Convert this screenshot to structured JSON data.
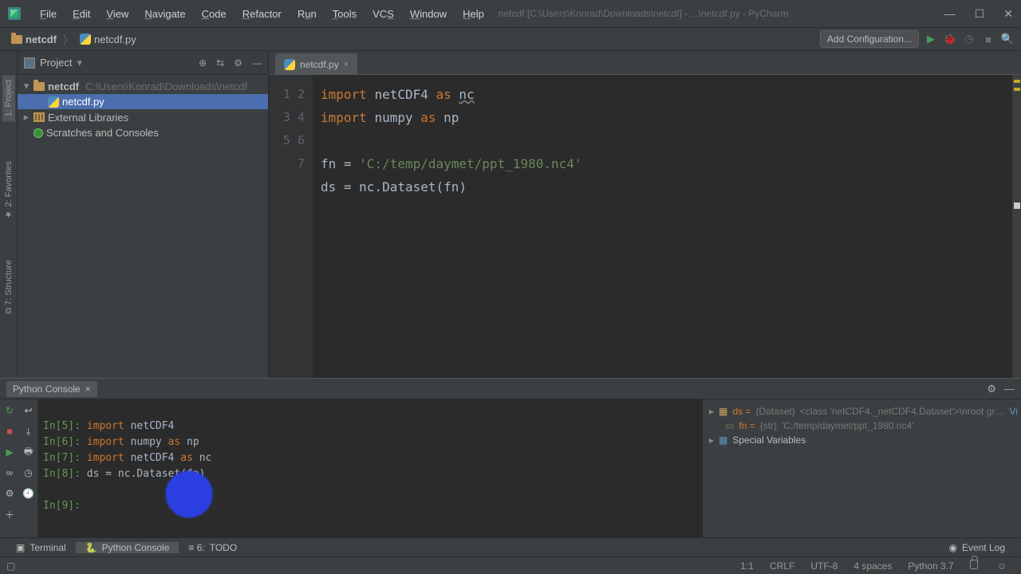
{
  "menu": {
    "items": [
      "File",
      "Edit",
      "View",
      "Navigate",
      "Code",
      "Refactor",
      "Run",
      "Tools",
      "VCS",
      "Window",
      "Help"
    ],
    "context": "netcdf [C:\\Users\\Konrad\\Downloads\\netcdf] - ...\\netcdf.py - PyCharm"
  },
  "breadcrumb": {
    "root": "netcdf",
    "file": "netcdf.py"
  },
  "navbar": {
    "add_config": "Add Configuration..."
  },
  "project_panel": {
    "title": "Project",
    "nodes": {
      "root": {
        "label": "netcdf",
        "path": "C:\\Users\\Konrad\\Downloads\\netcdf"
      },
      "file": {
        "label": "netcdf.py"
      },
      "ext": {
        "label": "External Libraries"
      },
      "scratch": {
        "label": "Scratches and Consoles"
      }
    }
  },
  "editor": {
    "tab": "netcdf.py",
    "lines": {
      "l1": {
        "kw": "import",
        "mod": "netCDF4",
        "as": "as",
        "alias": "nc"
      },
      "l2": {
        "kw": "import",
        "mod": "numpy",
        "as": "as",
        "alias": "np"
      },
      "l4": {
        "fn": "fn = ",
        "str": "'C:/temp/daymet/ppt_1980.nc4'"
      },
      "l5": "ds = nc.Dataset(fn)"
    },
    "line_numbers": [
      "1",
      "2",
      "3",
      "4",
      "5",
      "6",
      "7"
    ]
  },
  "console": {
    "tab": "Python Console",
    "entries": [
      {
        "prompt": "In[5]:",
        "code": "import netCDF4"
      },
      {
        "prompt": "In[6]:",
        "code": "import numpy as np"
      },
      {
        "prompt": "In[7]:",
        "code": "import netCDF4 as nc"
      },
      {
        "prompt": "In[8]:",
        "code": "ds = nc.Dataset(fn)"
      },
      {
        "prompt": "In[9]:",
        "code": ""
      }
    ],
    "vars": {
      "ds": {
        "name": "ds =",
        "type": "{Dataset}",
        "value": "<class 'netCDF4._netCDF4.Dataset'>\\nroot gr…",
        "view": "View"
      },
      "fn": {
        "name": "fn =",
        "type": "{str}",
        "value": "'C:/temp/daymet/ppt_1980.nc4'"
      },
      "special": "Special Variables"
    }
  },
  "bottom": {
    "terminal": "Terminal",
    "pyconsole": "Python Console",
    "todo": "TODO",
    "eventlog": "Event Log"
  },
  "status": {
    "pos": "1:1",
    "eol": "CRLF",
    "enc": "UTF-8",
    "indent": "4 spaces",
    "interp": "Python 3.7"
  }
}
